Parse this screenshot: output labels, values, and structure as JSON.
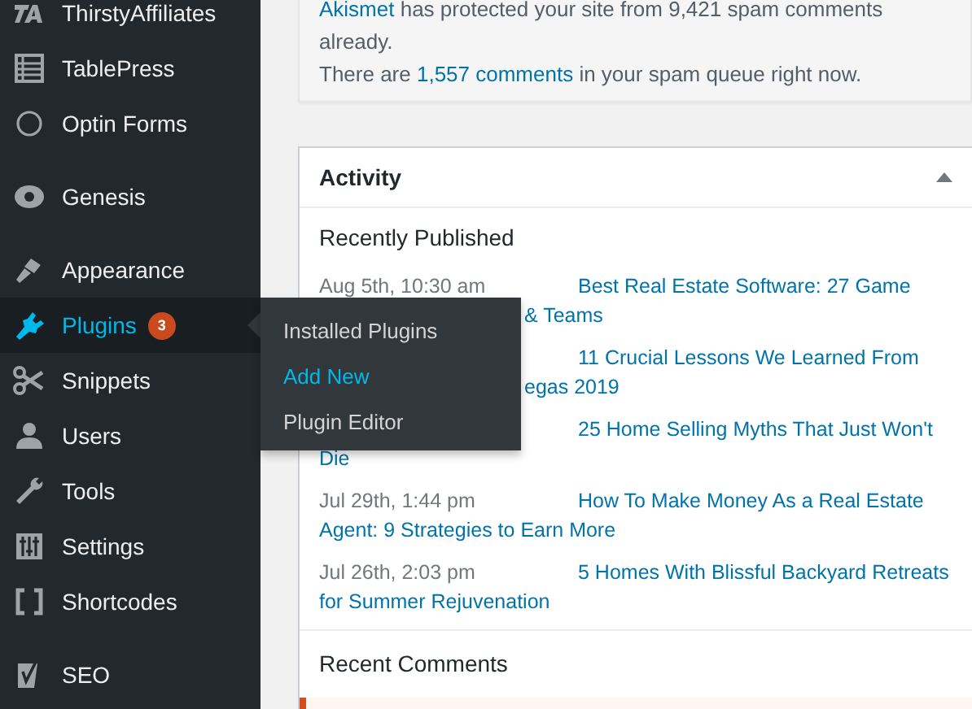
{
  "sidebar": {
    "items": [
      {
        "label": "ThirstyAffiliates",
        "selected": false
      },
      {
        "label": "TablePress",
        "selected": false
      },
      {
        "label": "Optin Forms",
        "selected": false
      },
      {
        "label": "Genesis",
        "selected": false
      },
      {
        "label": "Appearance",
        "selected": false
      },
      {
        "label": "Plugins",
        "selected": true,
        "badge": "3"
      },
      {
        "label": "Snippets",
        "selected": false
      },
      {
        "label": "Users",
        "selected": false
      },
      {
        "label": "Tools",
        "selected": false
      },
      {
        "label": "Settings",
        "selected": false
      },
      {
        "label": "Shortcodes",
        "selected": false
      },
      {
        "label": "SEO",
        "selected": false
      }
    ]
  },
  "flyout": {
    "items": [
      {
        "label": "Installed Plugins",
        "selected": false
      },
      {
        "label": "Add New",
        "selected": true
      },
      {
        "label": "Plugin Editor",
        "selected": false
      }
    ]
  },
  "akismet": {
    "lines": [
      [
        {
          "kind": "link",
          "text": "Akismet"
        },
        {
          "kind": "text",
          "text": " has protected your site from 9,421 spam comments already."
        }
      ],
      [
        {
          "kind": "text",
          "text": "There are "
        },
        {
          "kind": "link",
          "text": "1,557 comments"
        },
        {
          "kind": "text",
          "text": " in your spam queue right now."
        }
      ]
    ]
  },
  "activity": {
    "title": "Activity",
    "expanded": true,
    "section": "Recently Published",
    "rows": [
      {
        "date": "Aug 5th, 10:30 am",
        "title_lines": [
          "Best Real Estate Software: 27 Game",
          "& Teams"
        ],
        "partly_covered": true
      },
      {
        "title_lines": [
          "11 Crucial Lessons We Learned From",
          "egas 2019"
        ],
        "partly_covered": true
      },
      {
        "title_lines": [
          "25 Home Selling Myths That Just Won't",
          "Die"
        ]
      },
      {
        "date": "Jul 29th, 1:44 pm",
        "title_lines": [
          "How To Make Money As a Real Estate",
          "Agent: 9 Strategies to Earn More"
        ]
      },
      {
        "date": "Jul 26th, 2:03 pm",
        "title_lines": [
          "5 Homes With Blissful Backyard Retreats",
          "for Summer Rejuvenation"
        ]
      }
    ],
    "comments_title": "Recent Comments"
  }
}
